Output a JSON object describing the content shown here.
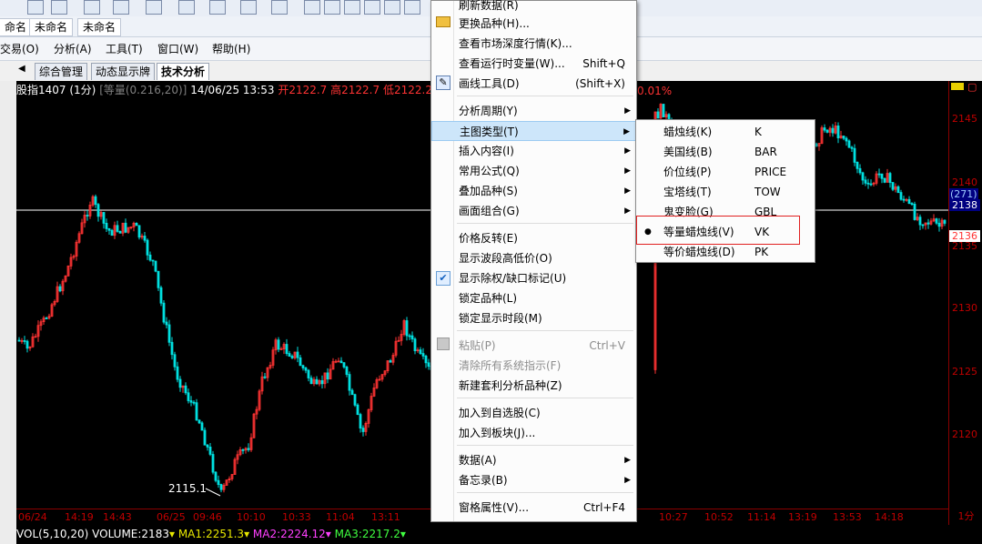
{
  "doc_tabs": [
    "命名",
    "未命名",
    "未命名"
  ],
  "menubar": [
    "交易(O)",
    "分析(A)",
    "工具(T)",
    "窗口(W)",
    "帮助(H)"
  ],
  "page_tabs": [
    "综合管理",
    "动态显示牌",
    "技术分析"
  ],
  "info": {
    "symbol": "股指1407 (1分)",
    "equal": "[等量(0.216,20)]",
    "datetime": "14/06/25 13:53",
    "open": "开2122.7",
    "high": "高2122.7",
    "low": "低2122.2",
    "pct": "0.01%"
  },
  "y_ticks": [
    "2145",
    "2140",
    "2135",
    "2130",
    "2125",
    "2120"
  ],
  "price_labels": {
    "upper": "(271)",
    "upper2": "2138",
    "current": "2136"
  },
  "x_ticks": [
    "06/24",
    "14:19",
    "14:43",
    "06/25",
    "09:46",
    "10:10",
    "10:33",
    "11:04",
    "13:11",
    "10:27",
    "10:52",
    "11:14",
    "13:19",
    "13:53",
    "14:18"
  ],
  "period_label": "1分",
  "low_annotation": "2115.1",
  "vol": {
    "label": "VOL(5,10,20)",
    "volume": "VOLUME:2183",
    "ma1": "MA1:2251.3",
    "ma2": "MA2:2224.12",
    "ma3": "MA3:2217.2"
  },
  "context_menu": {
    "items": [
      {
        "label": "刷新数据(R)",
        "shortcut": "",
        "submenu": false,
        "disabled": false
      },
      {
        "label": "更换品种(H)...",
        "shortcut": "",
        "submenu": false,
        "disabled": false
      },
      {
        "label": "查看市场深度行情(K)...",
        "shortcut": "",
        "submenu": false,
        "disabled": false
      },
      {
        "label": "查看运行时变量(W)...",
        "shortcut": "Shift+Q",
        "submenu": false,
        "disabled": false
      },
      {
        "label": "画线工具(D)",
        "shortcut": "(Shift+X)",
        "submenu": false,
        "disabled": false
      },
      {
        "label": "分析周期(Y)",
        "shortcut": "",
        "submenu": true,
        "disabled": false
      },
      {
        "label": "主图类型(T)",
        "shortcut": "",
        "submenu": true,
        "disabled": false
      },
      {
        "label": "插入内容(I)",
        "shortcut": "",
        "submenu": true,
        "disabled": false
      },
      {
        "label": "常用公式(Q)",
        "shortcut": "",
        "submenu": true,
        "disabled": false
      },
      {
        "label": "叠加品种(S)",
        "shortcut": "",
        "submenu": true,
        "disabled": false
      },
      {
        "label": "画面组合(G)",
        "shortcut": "",
        "submenu": true,
        "disabled": false
      },
      {
        "label": "价格反转(E)",
        "shortcut": "",
        "submenu": false,
        "disabled": false
      },
      {
        "label": "显示波段高低价(O)",
        "shortcut": "",
        "submenu": false,
        "disabled": false
      },
      {
        "label": "显示除权/缺口标记(U)",
        "shortcut": "",
        "submenu": false,
        "disabled": false
      },
      {
        "label": "锁定品种(L)",
        "shortcut": "",
        "submenu": false,
        "disabled": false
      },
      {
        "label": "锁定显示时段(M)",
        "shortcut": "",
        "submenu": false,
        "disabled": false
      },
      {
        "label": "粘贴(P)",
        "shortcut": "Ctrl+V",
        "submenu": false,
        "disabled": true
      },
      {
        "label": "清除所有系统指示(F)",
        "shortcut": "",
        "submenu": false,
        "disabled": true
      },
      {
        "label": "新建套利分析品种(Z)",
        "shortcut": "",
        "submenu": false,
        "disabled": false
      },
      {
        "label": "加入到自选股(C)",
        "shortcut": "",
        "submenu": false,
        "disabled": false
      },
      {
        "label": "加入到板块(J)...",
        "shortcut": "",
        "submenu": false,
        "disabled": false
      },
      {
        "label": "数据(A)",
        "shortcut": "",
        "submenu": true,
        "disabled": false
      },
      {
        "label": "备忘录(B)",
        "shortcut": "",
        "submenu": true,
        "disabled": false
      },
      {
        "label": "窗格属性(V)...",
        "shortcut": "Ctrl+F4",
        "submenu": false,
        "disabled": false
      }
    ]
  },
  "submenu": {
    "items": [
      {
        "label": "蜡烛线(K)",
        "code": "K"
      },
      {
        "label": "美国线(B)",
        "code": "BAR"
      },
      {
        "label": "价位线(P)",
        "code": "PRICE"
      },
      {
        "label": "宝塔线(T)",
        "code": "TOW"
      },
      {
        "label": "鬼变脸(G)",
        "code": "GBL"
      },
      {
        "label": "等量蜡烛线(V)",
        "code": "VK"
      },
      {
        "label": "等价蜡烛线(D)",
        "code": "PK"
      }
    ]
  },
  "colors": {
    "up": "#ff3333",
    "down": "#00e0e0",
    "axis": "#c00000",
    "highlight": "#cde6fa"
  }
}
